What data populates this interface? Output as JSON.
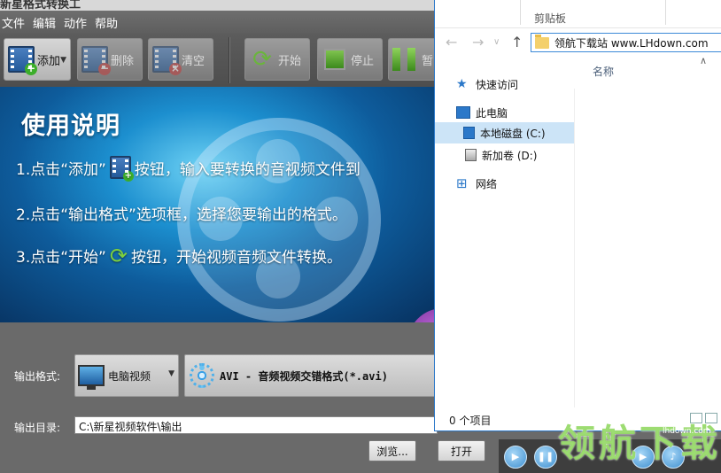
{
  "app": {
    "title": "新星格式转换工",
    "menu": [
      "文件",
      "编辑",
      "动作",
      "帮助"
    ],
    "toolbar": {
      "add": "添加",
      "delete": "删除",
      "clear": "清空",
      "start": "开始",
      "stop": "停止",
      "pause": "暂"
    },
    "banner": {
      "heading": "使用说明",
      "step1_a": "1.点击“添加”",
      "step1_b": "按钮，输入要转换的音视频文件到",
      "step2": "2.点击“输出格式”选项框，选择您要输出的格式。",
      "step3_a": "3.点击“开始”",
      "step3_b": "按钮，开始视频音频文件转换。"
    },
    "output": {
      "format_label": "输出格式:",
      "category": "电脑视频",
      "format": "AVI - 音频视频交错格式(*.avi)",
      "dir_label": "输出目录:",
      "dir_value": "C:\\新星视频软件\\输出",
      "browse": "浏览...",
      "open": "打开"
    }
  },
  "explorer": {
    "ribbon_caption": "剪贴板",
    "address": "领航下载站  www.LHdown.com",
    "column_name": "名称",
    "nav": {
      "quick_access": "快速访问",
      "this_pc": "此电脑",
      "local_disk": "本地磁盘 (C:)",
      "new_volume": "新加卷 (D:)",
      "network": "网络"
    },
    "status": "0 个项目"
  },
  "watermark": {
    "text": "领航下载",
    "url": "lhdown.com"
  }
}
